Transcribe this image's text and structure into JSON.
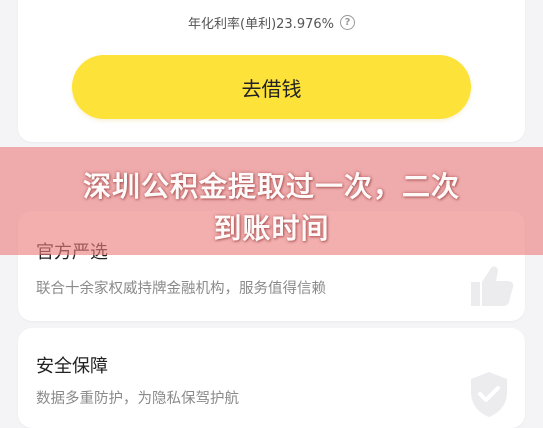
{
  "loan": {
    "rate_text": "年化利率(单利)23.976%",
    "help_icon": "question-circle-icon",
    "borrow_button": "去借钱"
  },
  "overlay": {
    "title_line1": "深圳公积金提取过一次，二次",
    "title_line2": "到账时间"
  },
  "features": [
    {
      "title": "官方严选",
      "desc": "联合十余家权威持牌金融机构，服务值得信赖",
      "icon": "thumbs-up-icon"
    },
    {
      "title": "安全保障",
      "desc": "数据多重防护，为隐私保驾护航",
      "icon": "shield-check-icon"
    }
  ],
  "colors": {
    "accent": "#fde23a",
    "overlay": "#ec7d7d",
    "background": "#f4f4f6"
  }
}
